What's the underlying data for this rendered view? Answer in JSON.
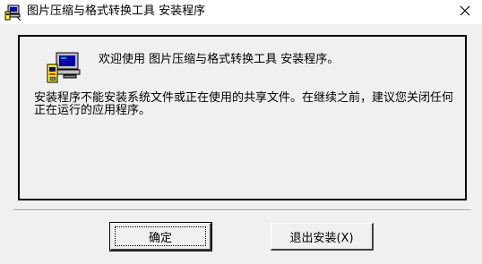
{
  "window": {
    "title": "图片压缩与格式转换工具 安装程序",
    "close_label": "✕"
  },
  "panel": {
    "welcome": "欢迎使用 图片压缩与格式转换工具 安装程序。",
    "message": "安装程序不能安装系统文件或正在使用的共享文件。在继续之前，建议您关闭任何正在运行的应用程序。"
  },
  "buttons": {
    "ok_label": "确定",
    "exit_label": "退出安装(X)"
  },
  "icons": {
    "title": "setup-computer-icon",
    "main": "setup-computer-icon",
    "close": "close-icon"
  }
}
